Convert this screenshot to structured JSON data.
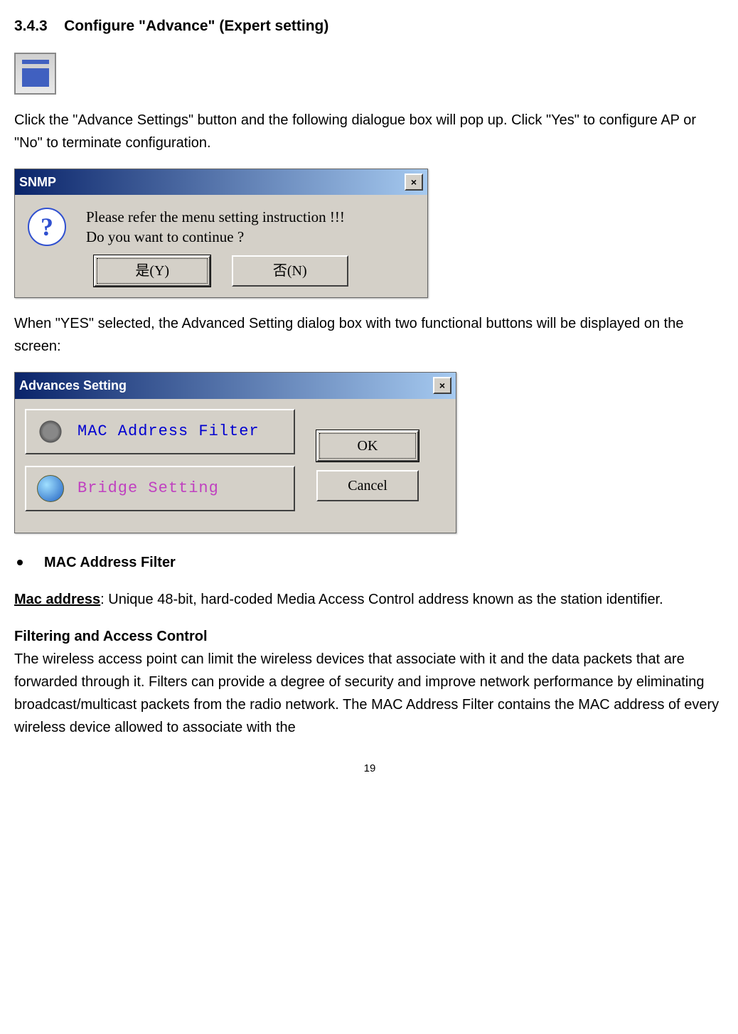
{
  "heading": {
    "number": "3.4.3",
    "title": "Configure \"Advance\" (Expert setting)"
  },
  "para1": "Click the \"Advance Settings\" button and the following dialogue box will pop up. Click \"Yes\" to configure AP or \"No\" to terminate configuration.",
  "dialog1": {
    "title": "SNMP",
    "line1": "Please refer the menu setting instruction !!!",
    "line2": "Do you want to continue ?",
    "yes_label": "是(Y)",
    "no_label": "否(N)"
  },
  "para2": "When \"YES\" selected, the Advanced Setting dialog box with two functional buttons will be displayed on the screen:",
  "dialog2": {
    "title": "Advances Setting",
    "mac_filter_label": "MAC Address Filter",
    "bridge_label": "Bridge Setting",
    "ok_label": "OK",
    "cancel_label": "Cancel"
  },
  "mac_section": {
    "bullet_heading": "MAC Address Filter",
    "mac_address_label": "Mac address",
    "mac_address_desc": ": Unique 48-bit, hard-coded Media Access Control address known as the station identifier.",
    "filtering_heading": "Filtering and Access Control",
    "filtering_body": "The wireless access point can limit the wireless devices that associate with it and the data packets that are forwarded through it. Filters can provide a degree of security and improve network performance by eliminating broadcast/multicast packets from the radio network. The MAC Address Filter contains the MAC address of every wireless device allowed to associate with the"
  },
  "page_number": "19"
}
